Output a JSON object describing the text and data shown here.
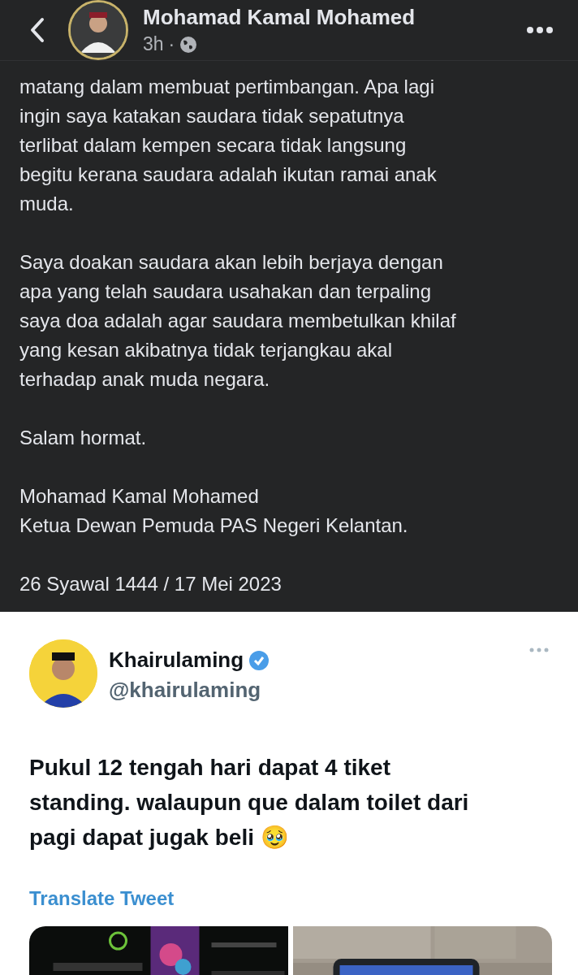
{
  "header": {
    "author": "Mohamad Kamal Mohamed",
    "time": "3h",
    "separator": "·"
  },
  "post": {
    "paragraphs": [
      [
        "matang dalam membuat pertimbangan. Apa lagi",
        "ingin saya katakan saudara tidak sepatutnya",
        "terlibat dalam kempen secara tidak langsung",
        "begitu kerana saudara adalah ikutan ramai anak",
        "muda."
      ],
      [
        "Saya doakan saudara akan lebih berjaya dengan",
        "apa yang telah saudara usahakan dan terpaling",
        "saya doa adalah agar saudara membetulkan khilaf",
        "yang kesan akibatnya tidak terjangkau akal",
        "terhadap anak muda negara."
      ],
      [
        "Salam hormat."
      ],
      [
        "Mohamad Kamal Mohamed",
        "Ketua Dewan Pemuda PAS Negeri Kelantan."
      ],
      [
        "26 Syawal 1444 / 17 Mei 2023"
      ]
    ]
  },
  "tweet": {
    "name": "Khairulaming",
    "verified": true,
    "handle": "@khairulaming",
    "lines": [
      "Pukul 12 tengah hari dapat 4 tiket",
      "standing. walaupun que dalam toilet dari",
      "pagi dapat jugak beli 🥹"
    ],
    "translate": "Translate Tweet"
  }
}
